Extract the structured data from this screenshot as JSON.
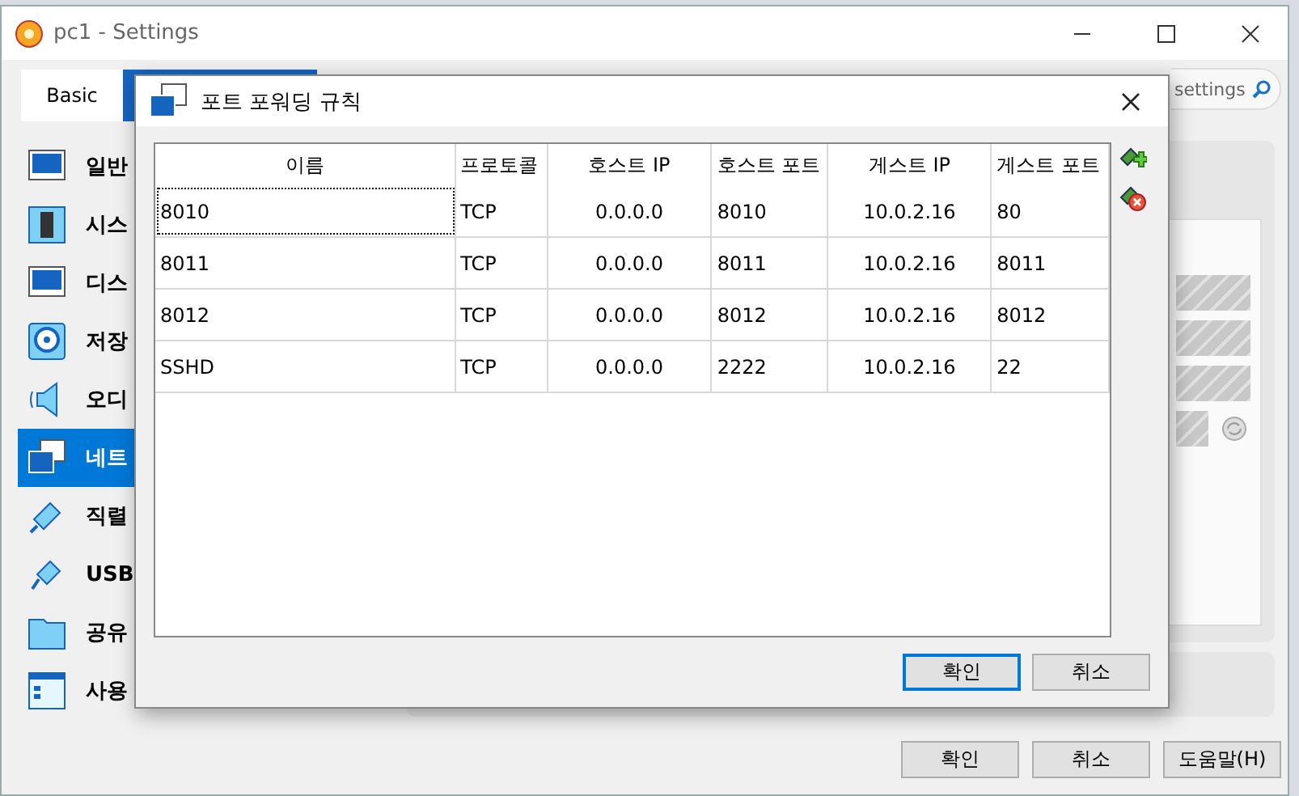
{
  "window": {
    "title": "pc1 - Settings",
    "search": {
      "placeholder": "settings"
    }
  },
  "tabs": [
    {
      "label": "Basic",
      "selected": false
    },
    {
      "selected": true
    }
  ],
  "sidebar": {
    "items": [
      {
        "label": "일반",
        "kind": "monitor",
        "selected": false
      },
      {
        "label": "시스",
        "kind": "chip",
        "selected": false
      },
      {
        "label": "디스",
        "kind": "monitor",
        "selected": false
      },
      {
        "label": "저장",
        "kind": "disk",
        "selected": false
      },
      {
        "label": "오디",
        "kind": "speaker",
        "selected": false
      },
      {
        "label": "네트",
        "kind": "network",
        "selected": true
      },
      {
        "label": "직렬",
        "kind": "plug",
        "selected": false
      },
      {
        "label": "USB",
        "kind": "usb",
        "selected": false
      },
      {
        "label": "공유",
        "kind": "folder",
        "selected": false
      },
      {
        "label": "사용",
        "kind": "window",
        "selected": false
      }
    ]
  },
  "buttons": [
    {
      "label": "확인"
    },
    {
      "label": "취소"
    },
    {
      "label": "도움말(H)"
    }
  ],
  "dialog": {
    "title": "포트 포워딩 규칙",
    "table": {
      "columns": [
        "이름",
        "프로토콜",
        "호스트 IP",
        "호스트 포트",
        "게스트 IP",
        "게스트 포트"
      ],
      "rows": [
        {
          "focused": true,
          "cells": [
            "8010",
            "TCP",
            "0.0.0.0",
            "8010",
            "10.0.2.16",
            "80"
          ]
        },
        {
          "focused": false,
          "cells": [
            "8011",
            "TCP",
            "0.0.0.0",
            "8011",
            "10.0.2.16",
            "8011"
          ]
        },
        {
          "focused": false,
          "cells": [
            "8012",
            "TCP",
            "0.0.0.0",
            "8012",
            "10.0.2.16",
            "8012"
          ]
        },
        {
          "focused": false,
          "cells": [
            "SSHD",
            "TCP",
            "0.0.0.0",
            "2222",
            "10.0.2.16",
            "22"
          ]
        }
      ]
    },
    "buttons": [
      {
        "label": "확인",
        "default": true
      },
      {
        "label": "취소",
        "default": false
      }
    ]
  }
}
